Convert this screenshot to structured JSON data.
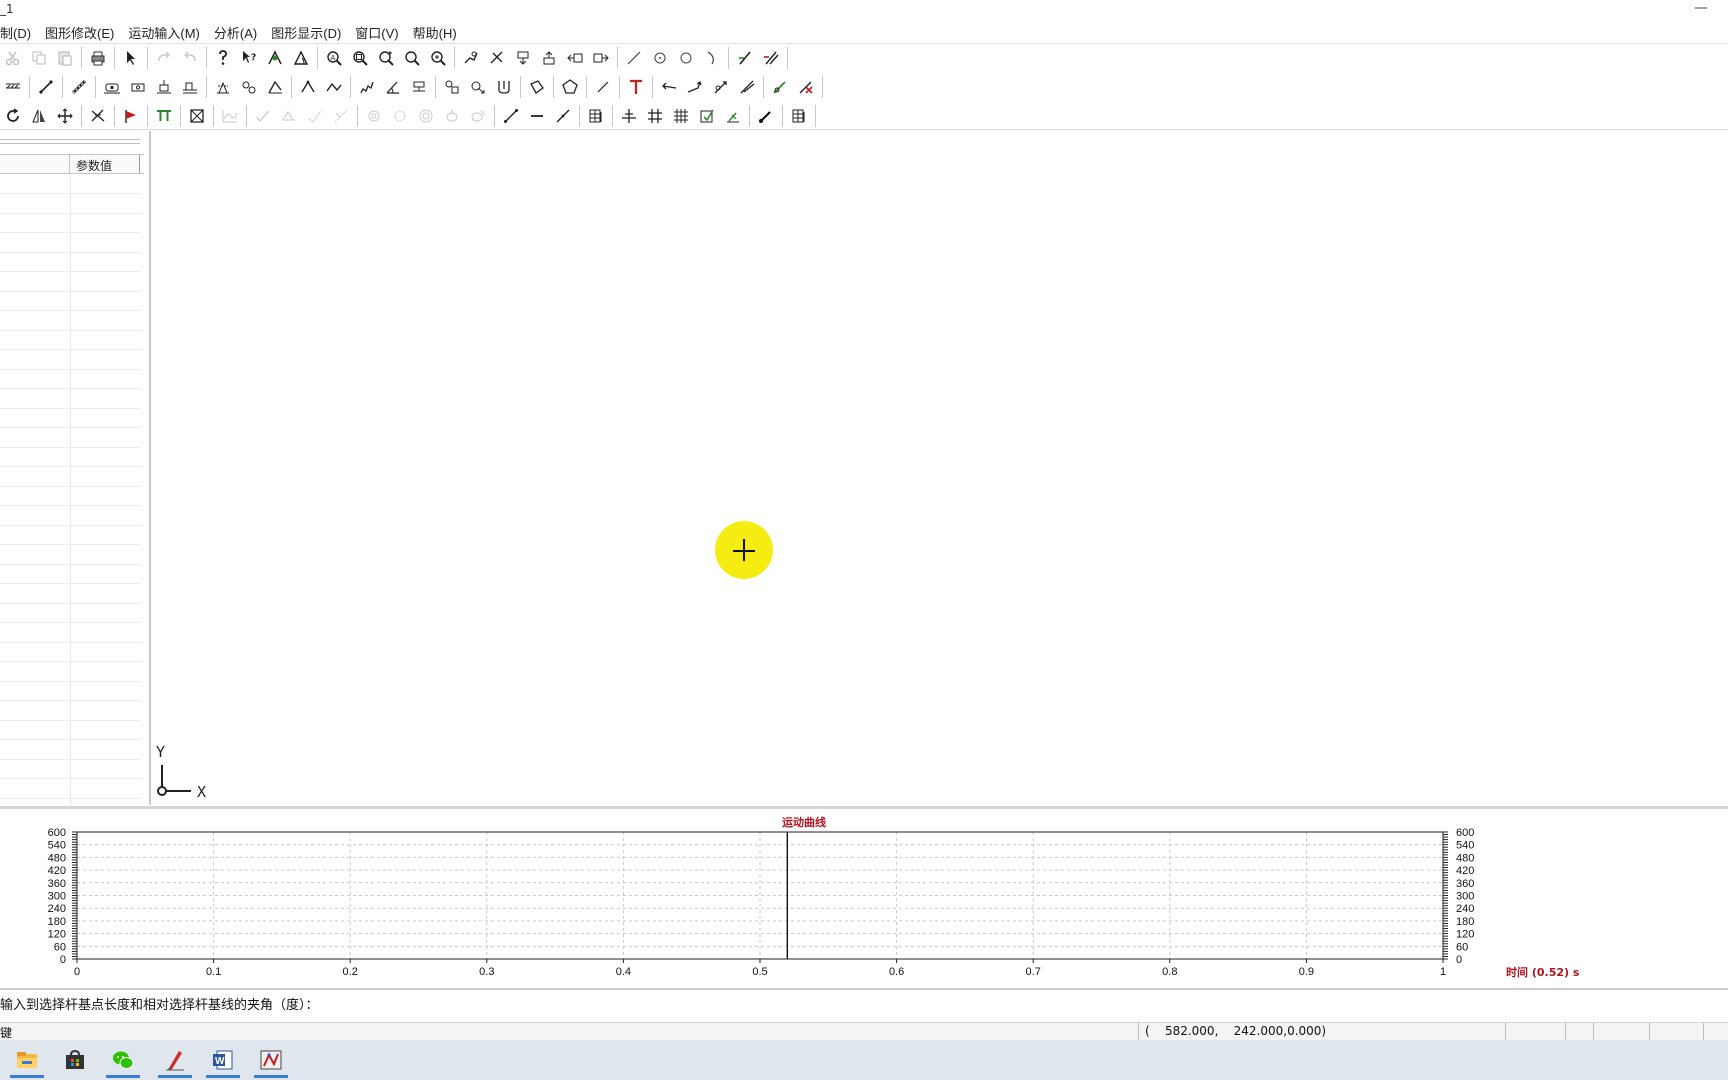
{
  "window": {
    "title": "_1",
    "minimize_glyph": "—"
  },
  "menu": [
    "制(D)",
    "图形修改(E)",
    "运动输入(M)",
    "分析(A)",
    "图形显示(D)",
    "窗口(V)",
    "帮助(H)"
  ],
  "param_panel": {
    "column_header": "参数值"
  },
  "canvas": {
    "axis_x_label": "X",
    "axis_y_label": "Y"
  },
  "chart_data": {
    "type": "line",
    "title": "运动曲线",
    "x_ticks": [
      "0",
      "0.1",
      "0.2",
      "0.3",
      "0.4",
      "0.5",
      "0.6",
      "0.7",
      "0.8",
      "0.9",
      "1"
    ],
    "y_ticks_left": [
      "0",
      "60",
      "120",
      "180",
      "240",
      "300",
      "360",
      "420",
      "480",
      "540",
      "600"
    ],
    "y_ticks_right": [
      "0",
      "60",
      "120",
      "180",
      "240",
      "300",
      "360",
      "420",
      "480",
      "540",
      "600"
    ],
    "xlim": [
      0,
      1
    ],
    "ylim": [
      0,
      600
    ],
    "grid": true,
    "current_time_marker": 0.52,
    "xlabel": "时间 (0.52) s",
    "series": []
  },
  "command_prompt": "输入到选择杆基点长度和相对选择杆基线的夹角（度）：",
  "status": {
    "left_text": "键",
    "coordinate": "(    582.000,    242.000,0.000)"
  },
  "taskbar_apps": [
    "file-explorer-icon",
    "store-icon",
    "wechat-icon",
    "pen-app-icon",
    "word-icon",
    "mechanism-app-icon"
  ],
  "colors": {
    "cursor_highlight": "#f5ec12",
    "chart_title": "#b0121e",
    "chart_xlabel": "#b0121e"
  }
}
